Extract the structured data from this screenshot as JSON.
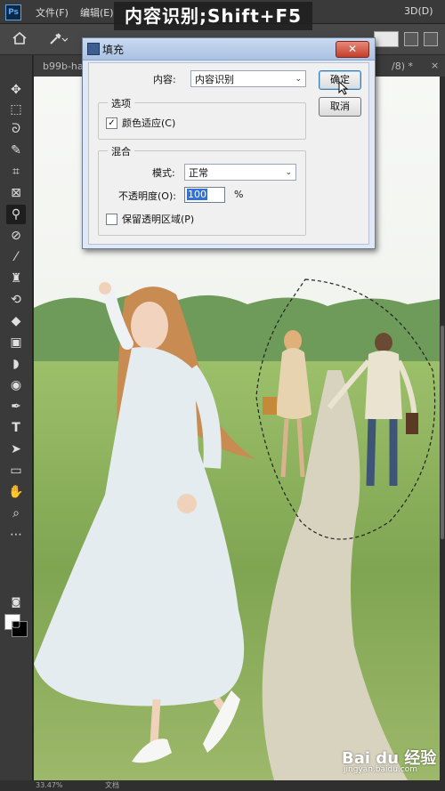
{
  "app": {
    "logo": "Ps"
  },
  "menubar": {
    "items": [
      "文件(F)",
      "编辑(E)",
      "3D(D)"
    ]
  },
  "overlay_caption": "内容识别;Shift+F5",
  "tabs": {
    "left": "b99b-ha",
    "right": "/8) *",
    "close": "×"
  },
  "dialog": {
    "title": "填充",
    "close_symbol": "✕",
    "content_label": "内容:",
    "content_value": "内容识别",
    "options_group": "选项",
    "color_adapt_label": "颜色适应(C)",
    "color_adapt_checked": true,
    "blend_group": "混合",
    "mode_label": "模式:",
    "mode_value": "正常",
    "opacity_label": "不透明度(O):",
    "opacity_value": "100",
    "opacity_unit": "%",
    "preserve_label": "保留透明区域(P)",
    "preserve_checked": false,
    "ok_label": "确定",
    "cancel_label": "取消"
  },
  "toolbar": {
    "tools": [
      "move-tool",
      "marquee-tool",
      "lasso-tool",
      "quick-select-tool",
      "crop-tool",
      "frame-tool",
      "eyedropper-tool",
      "healing-tool",
      "brush-tool",
      "stamp-tool",
      "history-brush-tool",
      "eraser-tool",
      "gradient-tool",
      "blur-tool",
      "dodge-tool",
      "pen-tool",
      "type-tool",
      "path-select-tool",
      "shape-tool",
      "hand-tool",
      "zoom-tool",
      "more-tool"
    ],
    "active": "eyedropper-tool"
  },
  "watermark": {
    "logo": "Bai du 经验",
    "site": "jingyan.baidu.com"
  },
  "status": {
    "zoom": "33.47%",
    "doc": "文档"
  }
}
